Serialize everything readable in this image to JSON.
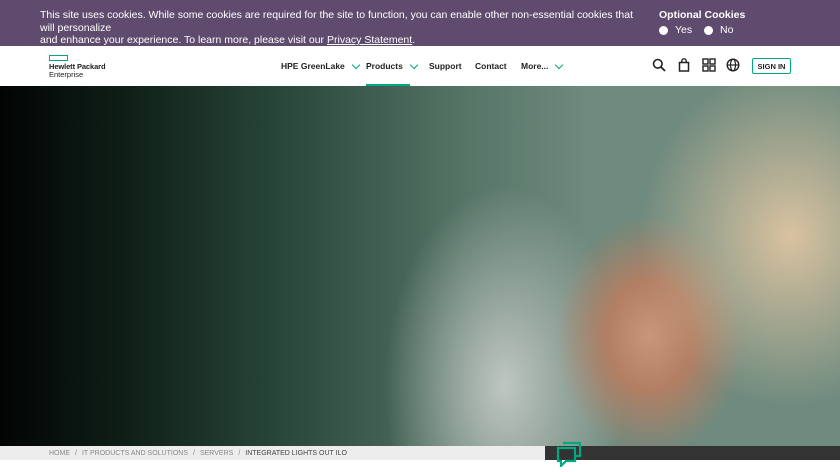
{
  "cookie": {
    "text_line1": "This site uses cookies. While some cookies are required for the site to function, you can enable other non-essential cookies that will personalize",
    "text_line2": "and enhance your experience. To learn more, please visit our ",
    "link": "Privacy Statement",
    "text_end": ".",
    "optional_title": "Optional Cookies",
    "yes": "Yes",
    "no": "No"
  },
  "brand": {
    "line1": "Hewlett Packard",
    "line2": "Enterprise",
    "accent": "#01a982"
  },
  "nav": {
    "greenlake": "HPE GreenLake",
    "products": "Products",
    "support": "Support",
    "contact": "Contact",
    "more": "More..."
  },
  "icons": [
    "search-icon",
    "cart-icon",
    "grid-icon",
    "globe-icon"
  ],
  "signin": "SIGN IN",
  "breadcrumb": {
    "home": "HOME",
    "it": "IT PRODUCTS AND SOLUTIONS",
    "servers": "SERVERS",
    "current": "INTEGRATED LIGHTS OUT ILO",
    "sep": "/"
  }
}
